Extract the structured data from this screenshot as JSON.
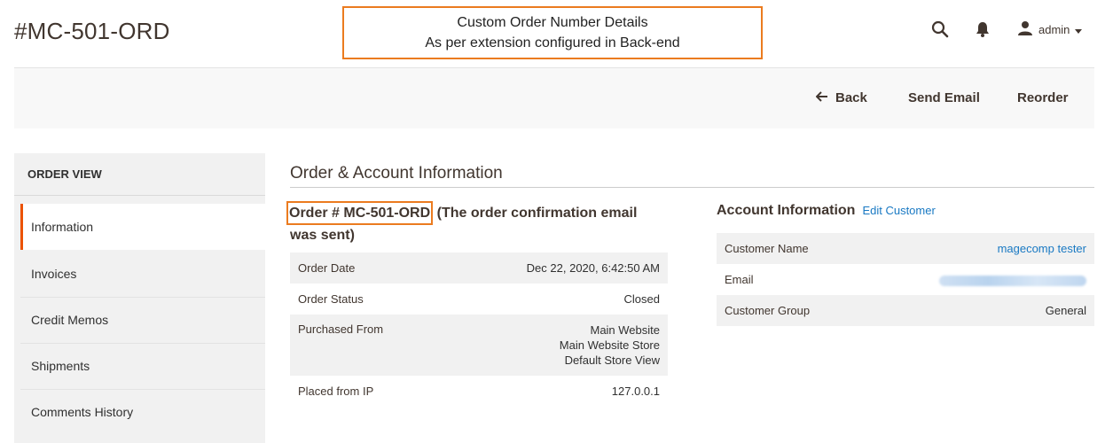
{
  "header": {
    "page_title": "#MC-501-ORD",
    "callout_line1": "Custom Order Number Details",
    "callout_line2": "As per extension configured in Back-end",
    "user_label": "admin",
    "icons": [
      "search-icon",
      "bell-icon",
      "user-icon",
      "caret-down-icon"
    ]
  },
  "actions": {
    "back": "Back",
    "send_email": "Send Email",
    "reorder": "Reorder"
  },
  "sidebar": {
    "title": "ORDER VIEW",
    "items": [
      {
        "label": "Information",
        "active": true
      },
      {
        "label": "Invoices"
      },
      {
        "label": "Credit Memos"
      },
      {
        "label": "Shipments"
      },
      {
        "label": "Comments History"
      }
    ]
  },
  "main": {
    "section_title": "Order & Account Information",
    "order": {
      "number_label": "Order # MC-501-ORD",
      "email_status": "(The order confirmation email was sent)",
      "rows": [
        {
          "label": "Order Date",
          "value": "Dec 22, 2020, 6:42:50 AM"
        },
        {
          "label": "Order Status",
          "value": "Closed"
        },
        {
          "label": "Purchased From",
          "lines": [
            "Main Website",
            "Main Website Store",
            "Default Store View"
          ]
        },
        {
          "label": "Placed from IP",
          "value": "127.0.0.1"
        }
      ]
    },
    "account": {
      "title": "Account Information",
      "edit_link": "Edit Customer",
      "rows": [
        {
          "label": "Customer Name",
          "value": "magecomp tester"
        },
        {
          "label": "Email",
          "value": ""
        },
        {
          "label": "Customer Group",
          "value": "General"
        }
      ]
    }
  },
  "colors": {
    "accent": "#eb5202",
    "callout_border": "#eb7b1f",
    "link": "#1979c3"
  }
}
